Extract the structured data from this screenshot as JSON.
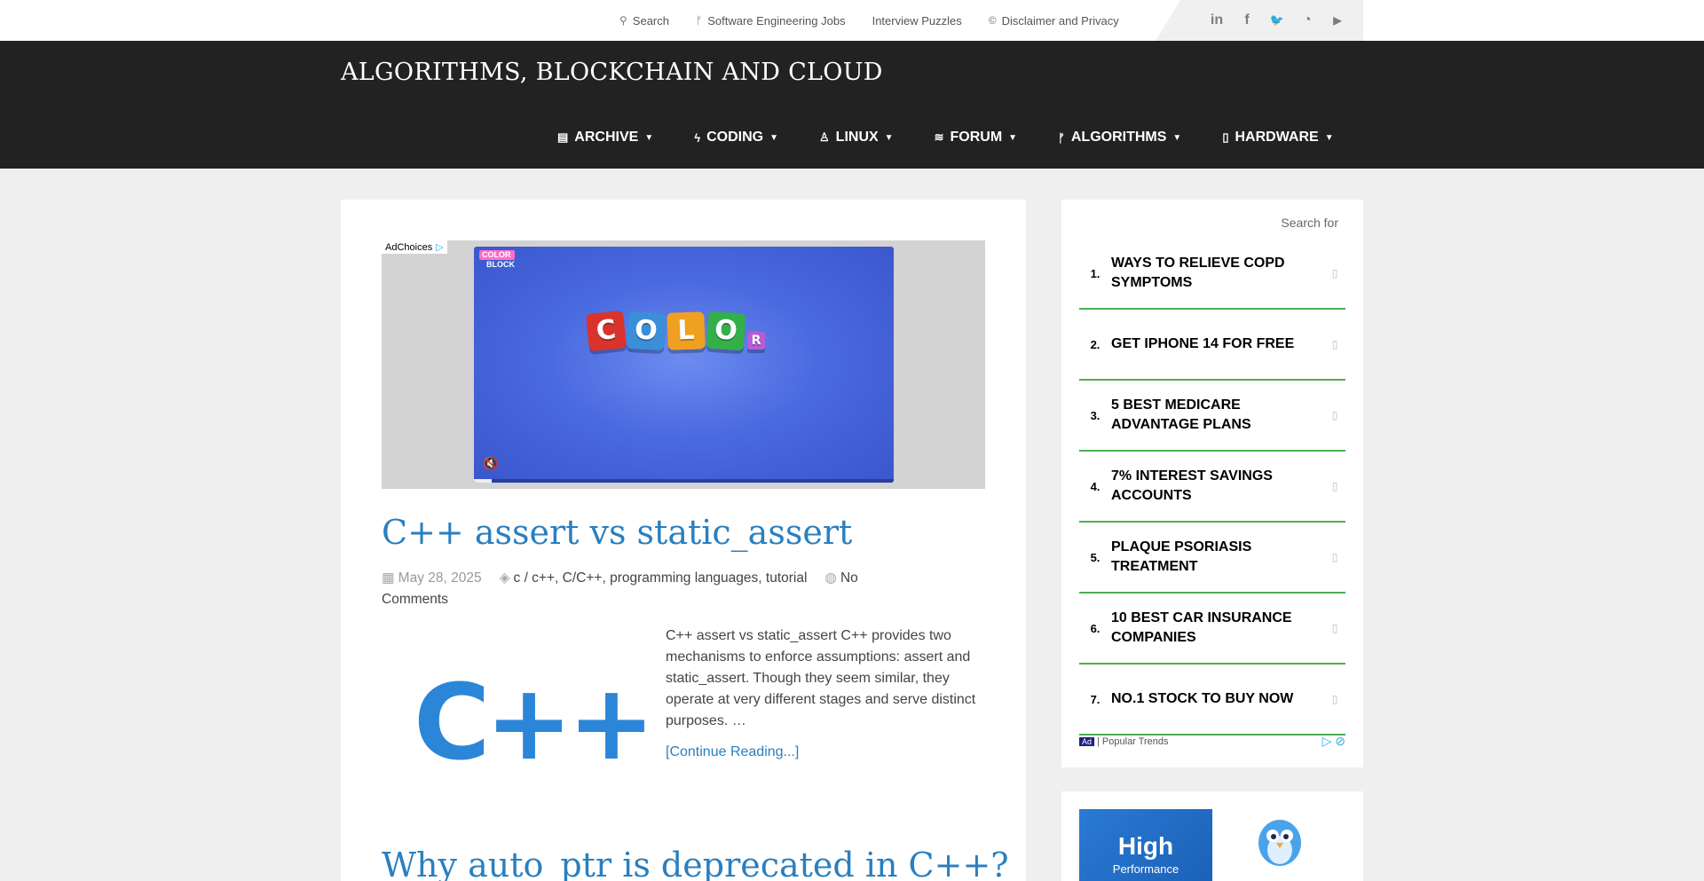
{
  "topbar": {
    "links": [
      {
        "icon": "search-icon",
        "glyph": "⚲",
        "label": "Search"
      },
      {
        "icon": "code-branch-icon",
        "glyph": "ᚠ",
        "label": "Software Engineering Jobs"
      },
      {
        "icon": "",
        "glyph": "",
        "label": "Interview Puzzles"
      },
      {
        "icon": "copyright-icon",
        "glyph": "©",
        "label": "Disclaimer and Privacy"
      }
    ],
    "social": [
      {
        "icon": "linkedin-icon",
        "glyph": "in"
      },
      {
        "icon": "facebook-icon",
        "glyph": "f"
      },
      {
        "icon": "twitter-icon",
        "glyph": "🐦"
      },
      {
        "icon": "rss-icon",
        "glyph": "◔"
      },
      {
        "icon": "youtube-icon",
        "glyph": "▶"
      }
    ]
  },
  "header": {
    "site_title": "ALGORITHMS, BLOCKCHAIN AND CLOUD",
    "nav": [
      {
        "icon": "archive-icon",
        "glyph": "▤",
        "label": "ARCHIVE"
      },
      {
        "icon": "bolt-icon",
        "glyph": "ϟ",
        "label": "CODING"
      },
      {
        "icon": "linux-icon",
        "glyph": "♙",
        "label": "LINUX"
      },
      {
        "icon": "forum-icon",
        "glyph": "≋",
        "label": "FORUM"
      },
      {
        "icon": "code-branch-icon",
        "glyph": "ᚠ",
        "label": "ALGORITHMS"
      },
      {
        "icon": "hardware-icon",
        "glyph": "▯",
        "label": "HARDWARE"
      }
    ]
  },
  "ad_player": {
    "adchoices": "AdChoices",
    "logo_top": "COLOR",
    "logo_bottom": "BLOCK",
    "tiles": [
      "C",
      "O",
      "L",
      "O",
      "R"
    ],
    "tile_colors": [
      "#d9342b",
      "#3a8fd8",
      "#f0a020",
      "#33b04a",
      "#b65cd6"
    ]
  },
  "post": {
    "title": "C++ assert vs static_assert",
    "date": "May 28, 2025",
    "tags": [
      "c / c++",
      "C/C++",
      "programming languages",
      "tutorial"
    ],
    "comments": "No Comments",
    "thumb_text": "C++",
    "excerpt": "C++ assert vs static_assert C++ provides two mechanisms to enforce assumptions: assert and static_assert. Though they seem similar, they operate at very different stages and serve distinct purposes.  …",
    "continue": "[Continue Reading...]"
  },
  "post2": {
    "title": "Why auto_ptr is deprecated in C++?"
  },
  "sidebar": {
    "search_label": "Search for",
    "ads": [
      {
        "num": "1.",
        "text": "WAYS TO RELIEVE COPD SYMPTOMS"
      },
      {
        "num": "2.",
        "text": "GET IPHONE 14 FOR FREE"
      },
      {
        "num": "3.",
        "text": "5 BEST MEDICARE ADVANTAGE PLANS"
      },
      {
        "num": "4.",
        "text": "7% INTEREST SAVINGS ACCOUNTS"
      },
      {
        "num": "5.",
        "text": "PLAQUE PSORIASIS TREATMENT"
      },
      {
        "num": "6.",
        "text": "10 BEST CAR INSURANCE COMPANIES"
      },
      {
        "num": "7.",
        "text": "NO.1 STOCK TO BUY NOW"
      }
    ],
    "ad_tag": "Ad",
    "ad_footer": "| Popular Trends"
  },
  "sidebar2": {
    "promo_big": "High",
    "promo_small": "Performance"
  }
}
